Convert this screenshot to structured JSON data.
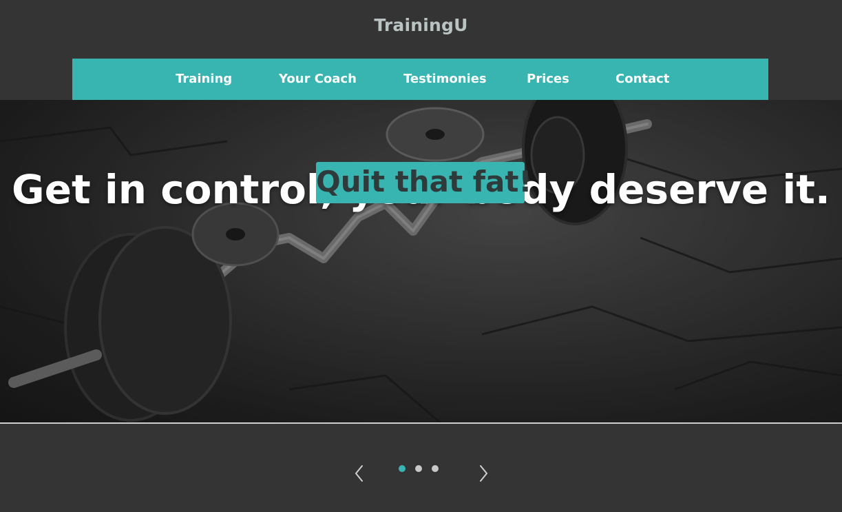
{
  "brand": {
    "name": "TrainingU"
  },
  "nav": {
    "items": [
      {
        "label": "Training"
      },
      {
        "label": "Your Coach"
      },
      {
        "label": "Testimonies"
      },
      {
        "label": "Prices"
      },
      {
        "label": "Contact"
      }
    ]
  },
  "hero": {
    "headline": "Get in control, your body deserve it.",
    "cta_label": "Quit that fat!"
  },
  "carousel": {
    "slide_count": 3,
    "active_index": 0
  },
  "colors": {
    "accent": "#38b5b0",
    "background": "#343434",
    "brand_text": "#b9c4c2"
  },
  "icons": {
    "prev": "chevron-left-icon",
    "next": "chevron-right-icon"
  }
}
